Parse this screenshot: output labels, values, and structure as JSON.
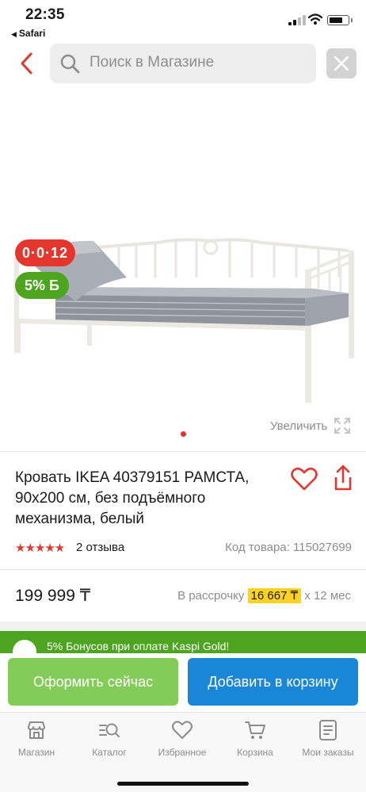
{
  "status_bar": {
    "time": "22:35",
    "back_app": "Safari"
  },
  "search": {
    "placeholder": "Поиск в Магазине"
  },
  "gallery": {
    "installment_badge": "0·0·12",
    "bonus_badge": "5% Б",
    "zoom_label": "Увеличить",
    "image_count": 1,
    "current_image": 1
  },
  "product": {
    "title": "Кровать IKEA 40379151 РАМСТА, 90x200 см, без подъёмного механизма, белый",
    "stars": "★★★★★",
    "rating": 5,
    "reviews": "2 отзыва",
    "sku": "Код товара: 115027699",
    "price": "199 999 ₸",
    "installment_prefix": "В рассрочку",
    "installment_amount": "16 667 ₸",
    "installment_suffix": "x 12 мес"
  },
  "promo": {
    "text": "5% Бонусов при оплате Kaspi Gold!"
  },
  "actions": {
    "buy_now": "Оформить сейчас",
    "add_to_cart": "Добавить в корзину"
  },
  "tabbar": {
    "items": [
      {
        "label": "Магазин",
        "icon": "store-icon"
      },
      {
        "label": "Каталог",
        "icon": "catalog-search-icon"
      },
      {
        "label": "Избранное",
        "icon": "heart-icon"
      },
      {
        "label": "Корзина",
        "icon": "cart-icon"
      },
      {
        "label": "Мои заказы",
        "icon": "orders-icon"
      }
    ]
  },
  "colors": {
    "accent_red": "#e5362d",
    "bonus_green": "#4da51f",
    "buy_green": "#84cc58",
    "cart_blue": "#1a86d6",
    "installment_yellow": "#ffd21f"
  }
}
